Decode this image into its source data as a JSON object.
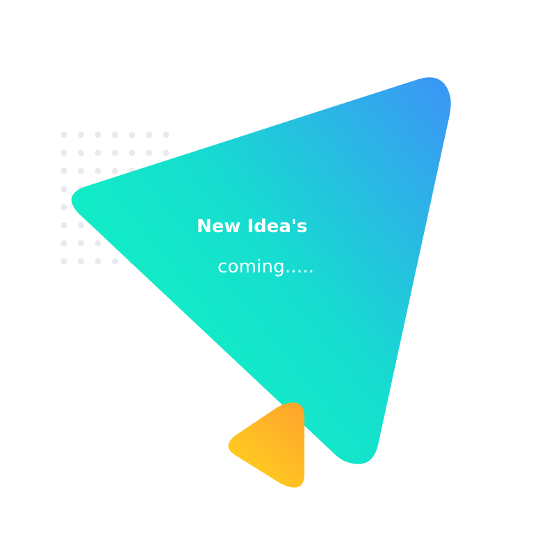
{
  "texts": {
    "headline": "New Idea's",
    "subline": "coming....."
  },
  "colors": {
    "background": "#ffffff",
    "text": "#ffffff",
    "large_triangle_gradient": [
      "#0ff5c0",
      "#3d93f8"
    ],
    "small_triangle_gradient": [
      "#ffd21e",
      "#ffa42d"
    ],
    "dot_pattern": "#e9e9ee"
  }
}
